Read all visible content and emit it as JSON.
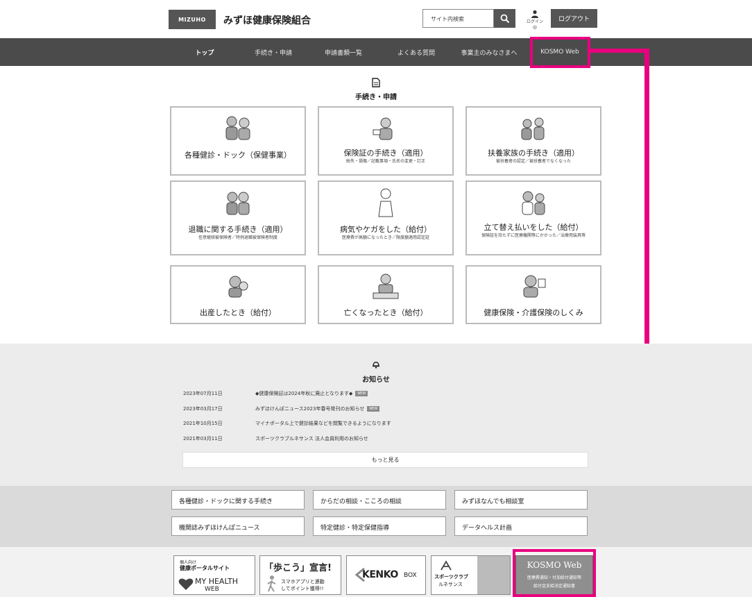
{
  "header": {
    "logo_text": "MIZUHO",
    "title": "みずほ健康保険組合",
    "search_placeholder": "サイト内検索",
    "login_label": "ログイン中",
    "logout_label": "ログアウト"
  },
  "nav": {
    "items": [
      {
        "label": "トップ"
      },
      {
        "label": "手続き・申請"
      },
      {
        "label": "申請書類一覧"
      },
      {
        "label": "よくある質問"
      },
      {
        "label": "事業主のみなさまへ"
      },
      {
        "label": "KOSMO Web"
      }
    ]
  },
  "procedures": {
    "title": "手続き・申請",
    "tiles": [
      {
        "title": "各種健診・ドック（保健事業）",
        "sub": ""
      },
      {
        "title": "保険証の手続き（適用）",
        "sub": "紛失・損傷／記載事項・氏名の変更・訂正"
      },
      {
        "title": "扶養家族の手続き（適用）",
        "sub": "被扶養者の認定／被扶養者でなくなった"
      },
      {
        "title": "退職に関する手続き（適用）",
        "sub": "任意継続被保険者／特例退職被保険者制度"
      },
      {
        "title": "病気やケガをした（給付）",
        "sub": "医療費が高額になったとき／限度額適用認定証"
      },
      {
        "title": "立て替え払いをした（給付）",
        "sub": "保険証を持たずに医療機関等にかかった／治療用装具等"
      },
      {
        "title": "出産したとき（給付）",
        "sub": ""
      },
      {
        "title": "亡くなったとき（給付）",
        "sub": ""
      },
      {
        "title": "健康保険・介護保険のしくみ",
        "sub": ""
      }
    ]
  },
  "news": {
    "title": "お知らせ",
    "items": [
      {
        "date": "2023年07月11日",
        "text": "◆健康保険証は2024年秋に廃止となります◆",
        "badge": "NEW"
      },
      {
        "date": "2023年03月17日",
        "text": "みずほけんぽニュース2023年春号発刊のお知らせ",
        "badge": "NEW"
      },
      {
        "date": "2021年10月15日",
        "text": "マイナポータル上で健診結果などを閲覧できるようになります",
        "badge": ""
      },
      {
        "date": "2021年03月11日",
        "text": "スポーツクラブルネサンス 法人会員利用のお知らせ",
        "badge": ""
      }
    ],
    "more_label": "もっと見る"
  },
  "links": [
    "各種健診・ドックに関する手続き",
    "からだの相談・こころの相談",
    "みずほなんでも相談室",
    "機関誌みずほけんぽニュース",
    "特定健診・特定保健指導",
    "データヘルス計画"
  ],
  "banners": {
    "myhealth": {
      "line1": "個人向け",
      "line2": "健康ポータルサイト",
      "brand": "MY HEALTH",
      "brand2": "WEB"
    },
    "walk": {
      "title": "「歩こう」宣言!",
      "sub1": "スマホアプリと連動",
      "sub2": "してポイント獲得!!"
    },
    "kenko": {
      "brand": "KENKO",
      "brand2": "BOX"
    },
    "sports": {
      "line1": "スポーツクラブ",
      "line2": "ルネサンス"
    },
    "kosmo": {
      "title": "KOSMO Web",
      "line1": "医療費通知・付加給付通知等",
      "line2": "給付金支給決定通知書"
    }
  },
  "colors": {
    "highlight": "#e8007e",
    "nav_bg": "#4b4b4b",
    "dark_button": "#555555"
  }
}
